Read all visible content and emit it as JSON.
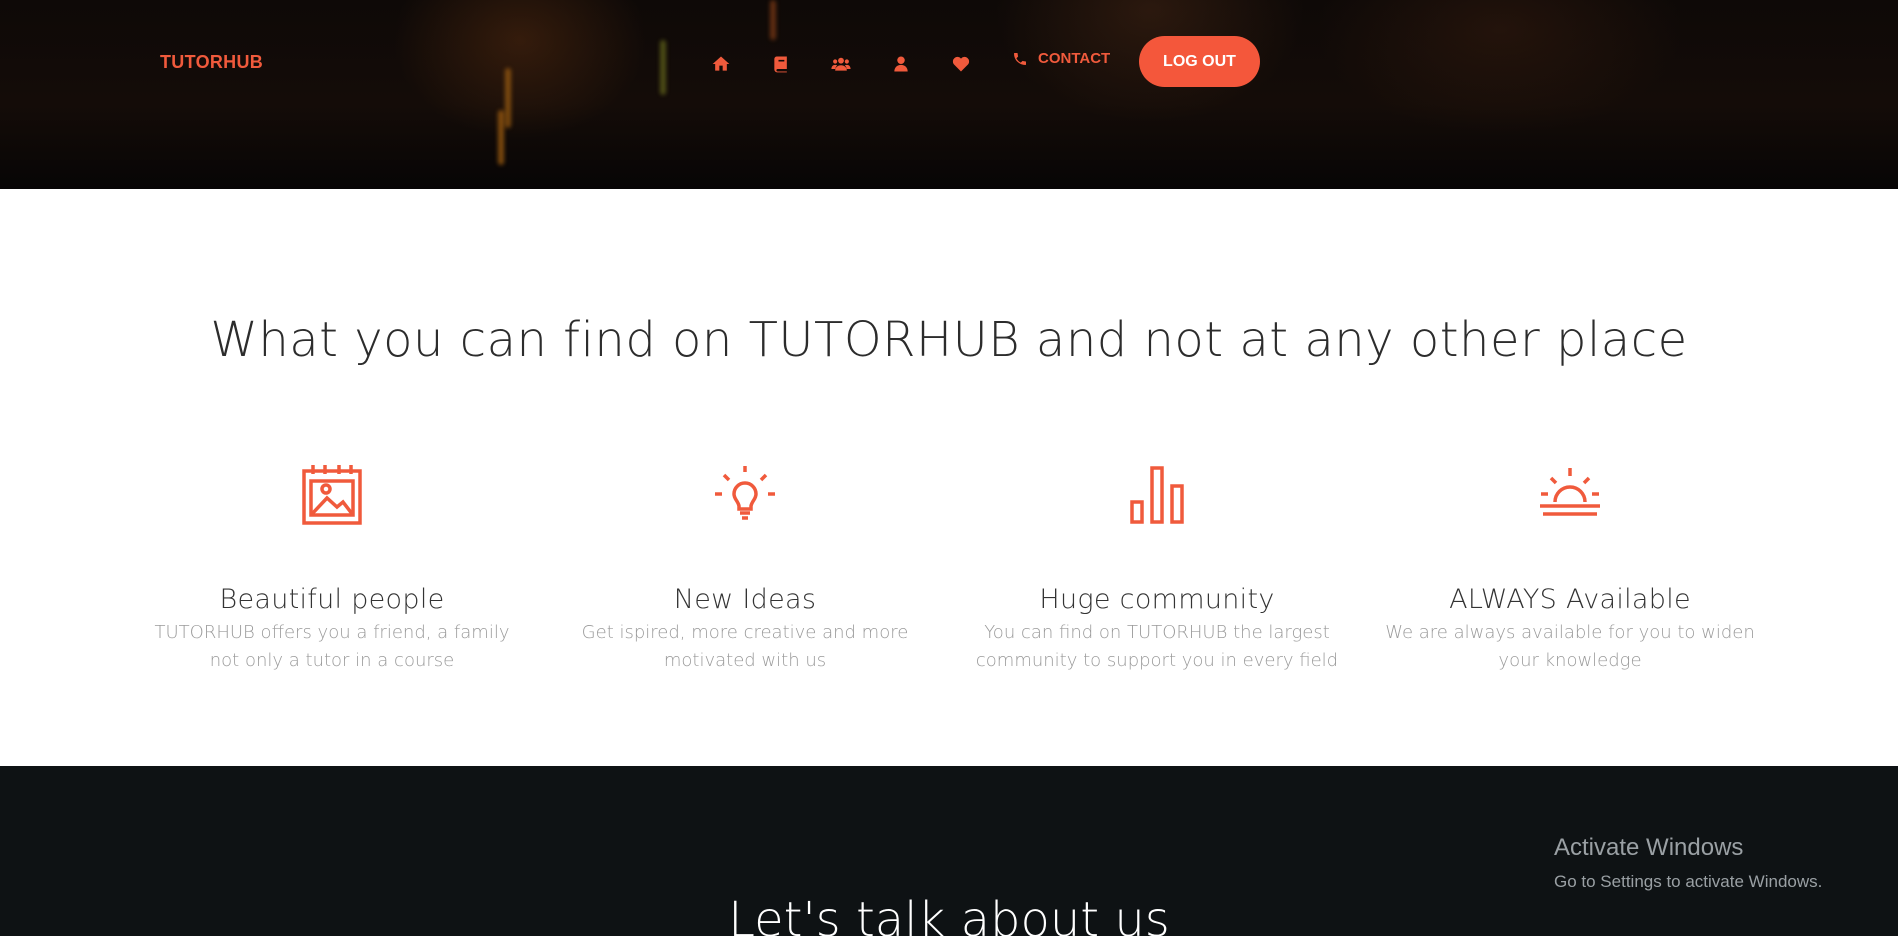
{
  "header": {
    "logo": "TUTORHUB",
    "nav_icons": [
      {
        "name": "home-icon"
      },
      {
        "name": "book-icon"
      },
      {
        "name": "users-icon"
      },
      {
        "name": "user-icon"
      },
      {
        "name": "heart-icon"
      }
    ],
    "contact_label": "CONTACT",
    "logout_label": "LOG OUT"
  },
  "features": {
    "headline": "What you can find on TUTORHUB and not at any other place",
    "items": [
      {
        "icon": "picture-calendar-icon",
        "title": "Beautiful people",
        "description": "TUTORHUB offers you a friend, a family not only a tutor in a course"
      },
      {
        "icon": "lightbulb-icon",
        "title": "New Ideas",
        "description": "Get ispired, more creative and more motivated with us"
      },
      {
        "icon": "bar-chart-icon",
        "title": "Huge community",
        "description": "You can find on TUTORHUB the largest community to support you in every field"
      },
      {
        "icon": "sunrise-icon",
        "title": "ALWAYS Available",
        "description": "We are always available for you to widen your knowledge"
      }
    ]
  },
  "about": {
    "title": "Let's talk about us"
  },
  "windows_watermark": {
    "line1": "Activate Windows",
    "line2": "Go to Settings to activate Windows."
  },
  "colors": {
    "accent": "#f05a3c",
    "header_bg": "#0e0907",
    "about_bg": "#0e1214"
  }
}
